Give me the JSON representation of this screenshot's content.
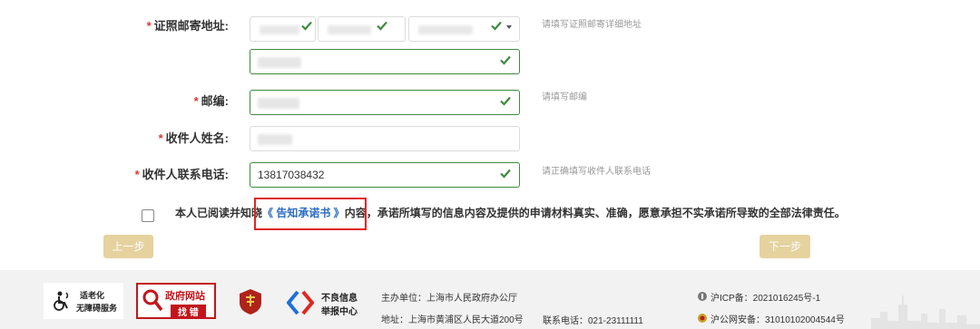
{
  "form": {
    "address": {
      "label": "证照邮寄地址:",
      "hint": "请填写证照邮寄详细地址"
    },
    "postcode": {
      "label": "邮编:",
      "hint": "请填写邮编"
    },
    "recipient": {
      "label": "收件人姓名:"
    },
    "phone": {
      "label": "收件人联系电话:",
      "value": "13817038432",
      "hint": "请正确填写收件人联系电话"
    },
    "required_mark": "*"
  },
  "agreement": {
    "prefix": "本人已阅读并知晓",
    "link": "《 告知承诺书 》",
    "suffix": "内容，承诺所填写的信息内容及提供的申请材料真实、准确，愿意承担不实承诺所导致的全部法律责任。"
  },
  "buttons": {
    "prev": "上一步",
    "next": "下一步"
  },
  "footer": {
    "logo_elder": {
      "line1": "适老化",
      "line2": "无障碍服务"
    },
    "logo_gov": {
      "line1": "政府网站",
      "line2": "找 错"
    },
    "logo_report": {
      "line1": "不良信息",
      "line2": "举报中心"
    },
    "host": "主办单位：上海市人民政府办公厅",
    "address": "地址：上海市黄浦区人民大道200号",
    "tel": "联系电话：021-23111111",
    "icp": "沪ICP备：2021016245号-1",
    "police": "沪公网安备：31010102004544号"
  },
  "colors": {
    "valid_border": "#3f8a3f",
    "required": "#d93a2b",
    "link": "#2b6cc4",
    "button": "#e5d29e",
    "highlight_box": "#e0261f"
  }
}
